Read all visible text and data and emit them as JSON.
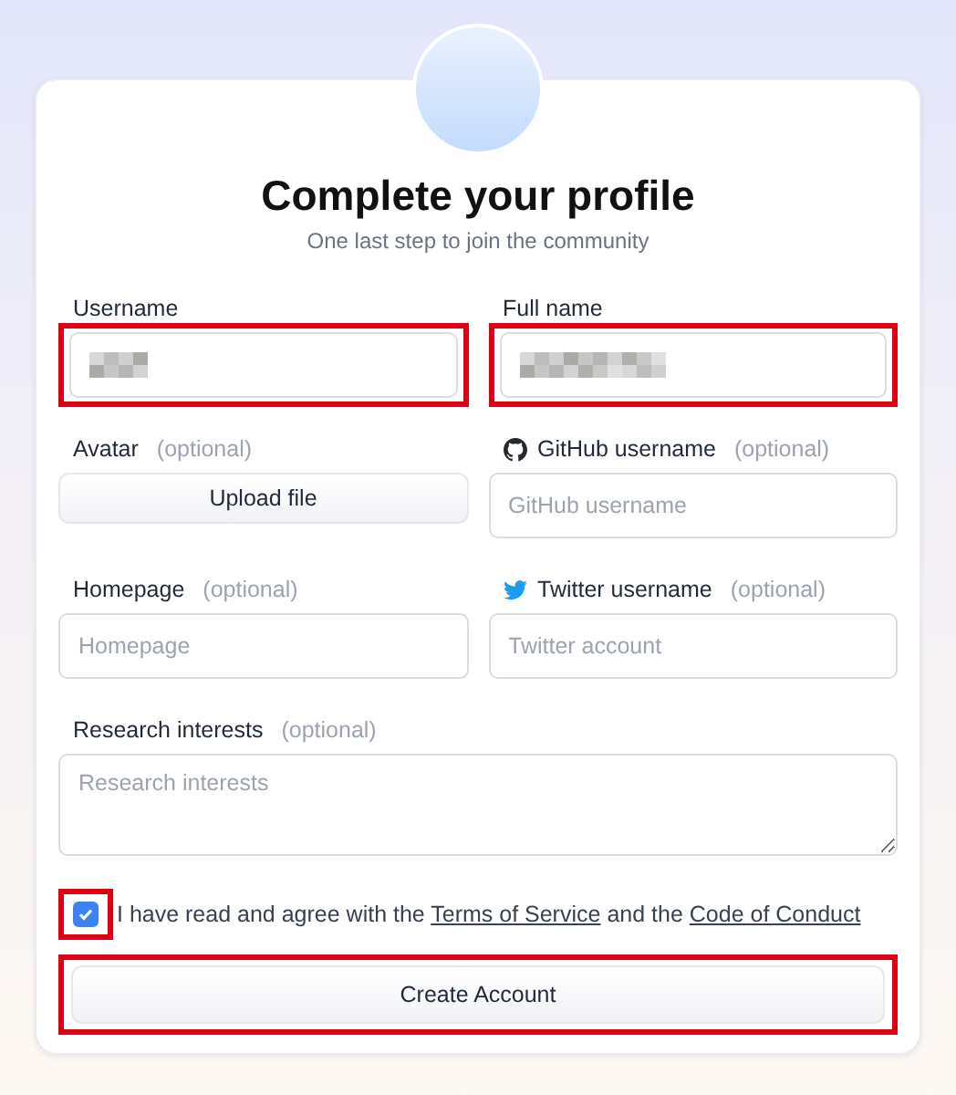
{
  "header": {
    "title": "Complete your profile",
    "subtitle": "One last step to join the community"
  },
  "fields": [
    {
      "kind": "redacted_input",
      "label": "Username",
      "highlighted": true
    },
    {
      "kind": "redacted_input",
      "label": "Full name",
      "highlighted": true
    },
    {
      "kind": "upload",
      "label": "Avatar",
      "optional_text": "(optional)",
      "button": "Upload file"
    },
    {
      "kind": "input",
      "label": "GitHub username",
      "optional_text": "(optional)",
      "placeholder": "GitHub username"
    },
    {
      "kind": "input",
      "label": "Homepage",
      "optional_text": "(optional)",
      "placeholder": "Homepage"
    },
    {
      "kind": "input",
      "label": "Twitter username",
      "optional_text": "(optional)",
      "placeholder": "Twitter account"
    },
    {
      "kind": "textarea",
      "label": "Research interests",
      "optional_text": "(optional)",
      "placeholder": "Research interests"
    }
  ],
  "agreement": {
    "checked": true,
    "highlighted": true,
    "parts": [
      {
        "kind": "text",
        "text": "I have read and agree with the"
      },
      {
        "kind": "link",
        "text": "Terms of Service"
      },
      {
        "kind": "text",
        "text": "and the"
      },
      {
        "kind": "link",
        "text": "Code of Conduct"
      }
    ]
  },
  "submit": {
    "label": "Create Account",
    "highlighted": true
  }
}
